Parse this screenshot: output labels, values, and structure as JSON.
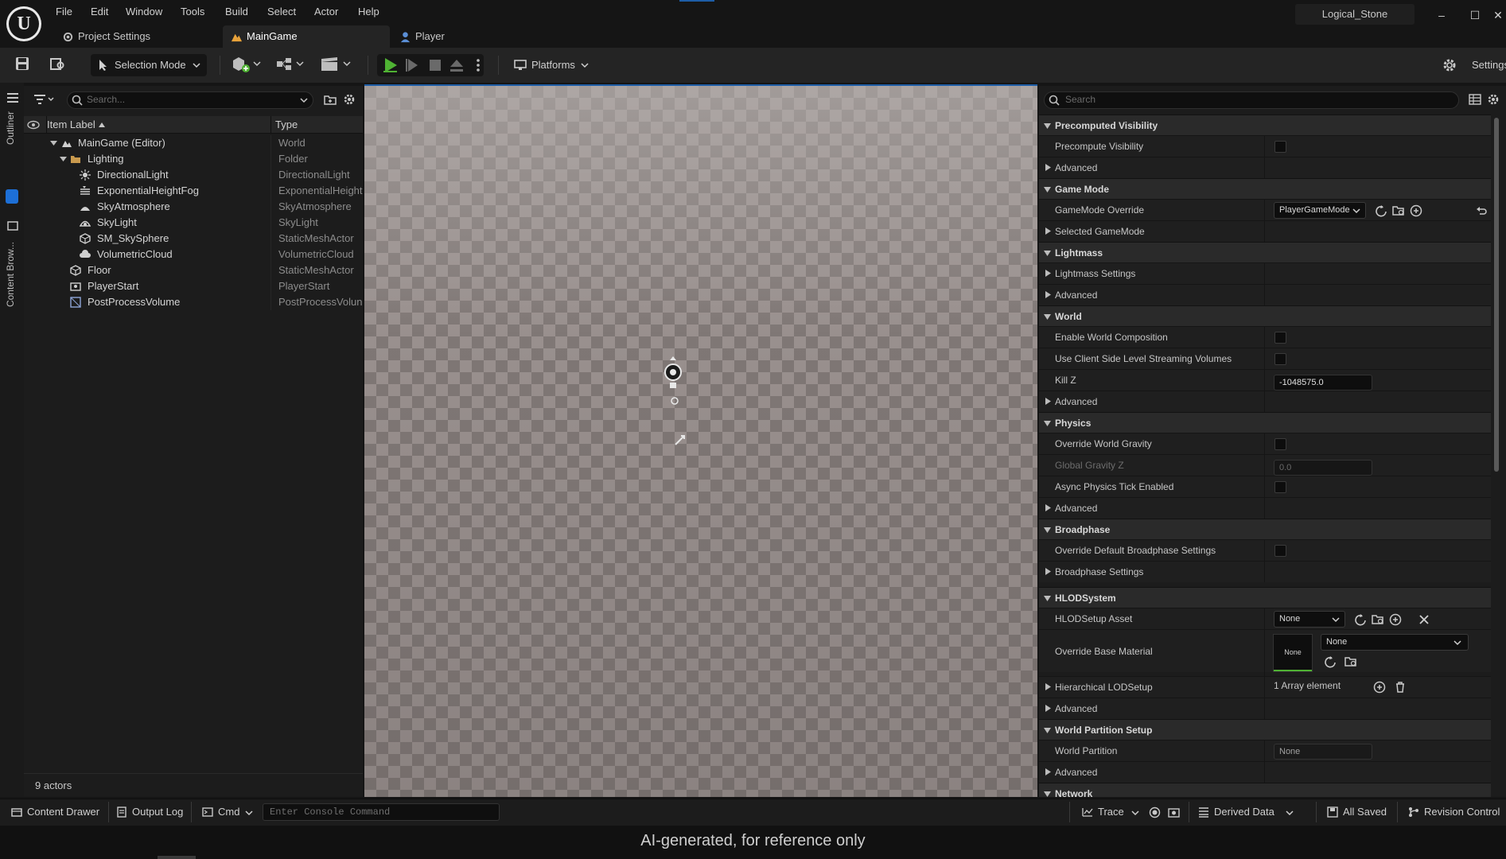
{
  "app": {
    "project_name": "Logical_Stone"
  },
  "menu": [
    "File",
    "Edit",
    "Window",
    "Tools",
    "Build",
    "Select",
    "Actor",
    "Help"
  ],
  "tabs": [
    {
      "label": "Project Settings",
      "icon": "project-settings-icon"
    },
    {
      "label": "MainGame",
      "icon": "level-icon",
      "active": true
    },
    {
      "label": "Player",
      "icon": "blueprint-icon"
    }
  ],
  "toolbar": {
    "selection_mode": "Selection Mode",
    "platforms": "Platforms",
    "settings": "Settings"
  },
  "left_edge": {
    "outliner_tab": "Outliner",
    "content_browser_tab": "Content Brow..."
  },
  "outliner": {
    "search_placeholder": "Search...",
    "col_label": "Item Label",
    "col_type": "Type",
    "rows": [
      {
        "label": "MainGame (Editor)",
        "type": "World",
        "icon": "world-icon"
      },
      {
        "label": "Lighting",
        "type": "Folder",
        "icon": "folder-icon"
      },
      {
        "label": "DirectionalLight",
        "type": "DirectionalLight",
        "icon": "directional-light-icon"
      },
      {
        "label": "ExponentialHeightFog",
        "type": "ExponentialHeightF",
        "icon": "fog-icon"
      },
      {
        "label": "SkyAtmosphere",
        "type": "SkyAtmosphere",
        "icon": "sky-atmosphere-icon"
      },
      {
        "label": "SkyLight",
        "type": "SkyLight",
        "icon": "skylight-icon"
      },
      {
        "label": "SM_SkySphere",
        "type": "StaticMeshActor",
        "icon": "static-mesh-icon"
      },
      {
        "label": "VolumetricCloud",
        "type": "VolumetricCloud",
        "icon": "cloud-icon"
      },
      {
        "label": "Floor",
        "type": "StaticMeshActor",
        "icon": "static-mesh-icon"
      },
      {
        "label": "PlayerStart",
        "type": "PlayerStart",
        "icon": "player-start-icon"
      },
      {
        "label": "PostProcessVolume",
        "type": "PostProcessVolun",
        "icon": "post-process-icon"
      }
    ],
    "footer": "9 actors"
  },
  "details": {
    "search_placeholder": "Search",
    "sections": {
      "precomputed_visibility": "Precomputed Visibility",
      "game_mode": "Game Mode",
      "lightmass": "Lightmass",
      "world": "World",
      "physics": "Physics",
      "broadphase": "Broadphase",
      "hlod": "HLODSystem",
      "world_partition": "World Partition Setup",
      "network": "Network"
    },
    "props": {
      "precompute_visibility": "Precompute Visibility",
      "advanced": "Advanced",
      "gamemode_override": "GameMode Override",
      "gamemode_value": "PlayerGameMode",
      "selected_gamemode": "Selected GameMode",
      "lightmass_settings": "Lightmass Settings",
      "enable_world_composition": "Enable World Composition",
      "client_side_streaming": "Use Client Side Level Streaming Volumes",
      "kill_z": "Kill Z",
      "kill_z_value": "-1048575.0",
      "override_world_gravity": "Override World Gravity",
      "global_gravity_z": "Global Gravity Z",
      "global_gravity_z_value": "0.0",
      "async_physics": "Async Physics Tick Enabled",
      "override_broadphase": "Override Default Broadphase Settings",
      "broadphase_settings": "Broadphase Settings",
      "hlod_setup_asset": "HLODSetup Asset",
      "hlod_setup_value": "None",
      "override_base_material": "Override Base Material",
      "material_thumb": "None",
      "material_value": "None",
      "hierarchical_lod": "Hierarchical LODSetup",
      "hierarchical_lod_value": "1 Array element",
      "world_partition": "World Partition",
      "world_partition_value": "None"
    }
  },
  "statusbar": {
    "content_drawer": "Content Drawer",
    "output_log": "Output Log",
    "cmd": "Cmd",
    "console_placeholder": "Enter Console Command",
    "trace": "Trace",
    "derived_data": "Derived Data",
    "all_saved": "All Saved",
    "revision_control": "Revision Control"
  },
  "caption": "AI-generated, for reference only",
  "colors": {
    "accent_blue": "#1d5da6",
    "play_green": "#4fb233",
    "viewport_checker": "#8a8280"
  }
}
